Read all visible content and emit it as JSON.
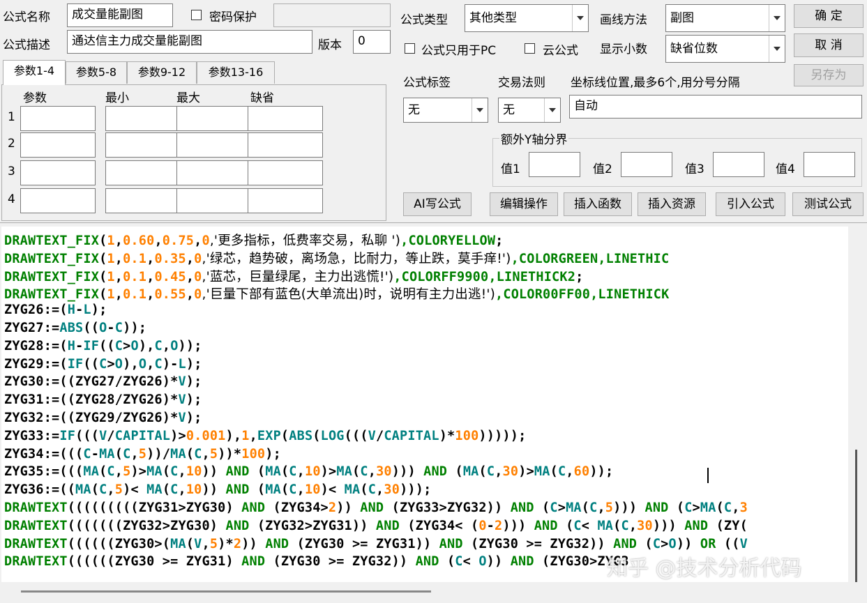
{
  "header": {
    "name_label": "公式名称",
    "name_value": "成交量能副图",
    "password_label": "密码保护",
    "desc_label": "公式描述",
    "desc_value": "通达信主力成交量能副图",
    "version_label": "版本",
    "version_value": "0"
  },
  "right_panel": {
    "type_label": "公式类型",
    "type_value": "其他类型",
    "draw_label": "画线方法",
    "draw_value": "副图",
    "pc_only_label": "公式只用于PC",
    "cloud_label": "云公式",
    "decimals_label": "显示小数",
    "decimals_value": "缺省位数",
    "tag_label": "公式标签",
    "tag_value": "无",
    "rule_label": "交易法则",
    "rule_value": "无",
    "axis_label": "坐标线位置,最多6个,用分号分隔",
    "axis_value": "自动",
    "extra_y_label": "额外Y轴分界",
    "values": [
      "值1",
      "值2",
      "值3",
      "值4"
    ]
  },
  "buttons": {
    "ok": "确 定",
    "cancel": "取 消",
    "save_as": "另存为",
    "ai": "AI写公式",
    "edit_ops": "编辑操作",
    "insert_func": "插入函数",
    "insert_res": "插入资源",
    "import": "引入公式",
    "test": "测试公式"
  },
  "tabs": [
    "参数1-4",
    "参数5-8",
    "参数9-12",
    "参数13-16"
  ],
  "params": {
    "headers": [
      "参数",
      "最小",
      "最大",
      "缺省"
    ],
    "rows": [
      "1",
      "2",
      "3",
      "4"
    ]
  },
  "colors": {
    "keyword": "#008000",
    "number": "#ff8000",
    "function": "#008080",
    "plain": "#000000",
    "string": "#000000"
  },
  "code_lines": [
    [
      [
        "DRAWTEXT_FIX",
        "k"
      ],
      [
        "(",
        "p"
      ],
      [
        "1",
        "n"
      ],
      [
        ",",
        "p"
      ],
      [
        "0.60",
        "n"
      ],
      [
        ",",
        "p"
      ],
      [
        "0.75",
        "n"
      ],
      [
        ",",
        "p"
      ],
      [
        "0",
        "n"
      ],
      [
        ",'更多指标，低费率交易，私聊 ')",
        "s"
      ],
      [
        ",COLORYELLOW",
        "k"
      ],
      [
        ";",
        "p"
      ]
    ],
    [
      [
        "DRAWTEXT_FIX",
        "k"
      ],
      [
        "(",
        "p"
      ],
      [
        "1",
        "n"
      ],
      [
        ",",
        "p"
      ],
      [
        "0.1",
        "n"
      ],
      [
        ",",
        "p"
      ],
      [
        "0.35",
        "n"
      ],
      [
        ",",
        "p"
      ],
      [
        "0",
        "n"
      ],
      [
        ",'绿芯，趋势破，离场急，比耐力，等止跌，莫手痒!')",
        "s"
      ],
      [
        ",COLORGREEN,LINETHIC",
        "k"
      ]
    ],
    [
      [
        "DRAWTEXT_FIX",
        "k"
      ],
      [
        "(",
        "p"
      ],
      [
        "1",
        "n"
      ],
      [
        ",",
        "p"
      ],
      [
        "0.1",
        "n"
      ],
      [
        ",",
        "p"
      ],
      [
        "0.45",
        "n"
      ],
      [
        ",",
        "p"
      ],
      [
        "0",
        "n"
      ],
      [
        ",'蓝芯，巨量绿尾，主力出逃慌!')",
        "s"
      ],
      [
        ",COLORFF9900,LINETHICK2",
        "k"
      ],
      [
        ";",
        "p"
      ]
    ],
    [
      [
        "DRAWTEXT_FIX",
        "k"
      ],
      [
        "(",
        "p"
      ],
      [
        "1",
        "n"
      ],
      [
        ",",
        "p"
      ],
      [
        "0.1",
        "n"
      ],
      [
        ",",
        "p"
      ],
      [
        "0.55",
        "n"
      ],
      [
        ",",
        "p"
      ],
      [
        "0",
        "n"
      ],
      [
        ",'巨量下部有蓝色(大单流出)时，说明有主力出逃!')",
        "s"
      ],
      [
        ",COLOR00FF00,LINETHICK",
        "k"
      ]
    ],
    [
      [
        "ZYG26:=(",
        "p"
      ],
      [
        "H",
        "f"
      ],
      [
        "-",
        "p"
      ],
      [
        "L",
        "f"
      ],
      [
        ");",
        "p"
      ]
    ],
    [
      [
        "ZYG27:=",
        "p"
      ],
      [
        "ABS",
        "f"
      ],
      [
        "((",
        "p"
      ],
      [
        "O",
        "f"
      ],
      [
        "-",
        "p"
      ],
      [
        "C",
        "f"
      ],
      [
        "));",
        "p"
      ]
    ],
    [
      [
        "ZYG28:=(",
        "p"
      ],
      [
        "H",
        "f"
      ],
      [
        "-",
        "p"
      ],
      [
        "IF",
        "f"
      ],
      [
        "((",
        "p"
      ],
      [
        "C",
        "f"
      ],
      [
        ">",
        "p"
      ],
      [
        "O",
        "f"
      ],
      [
        "),",
        "p"
      ],
      [
        "C",
        "f"
      ],
      [
        ",",
        "p"
      ],
      [
        "O",
        "f"
      ],
      [
        "));",
        "p"
      ]
    ],
    [
      [
        "ZYG29:=(",
        "p"
      ],
      [
        "IF",
        "f"
      ],
      [
        "((",
        "p"
      ],
      [
        "C",
        "f"
      ],
      [
        ">",
        "p"
      ],
      [
        "O",
        "f"
      ],
      [
        "),",
        "p"
      ],
      [
        "O",
        "f"
      ],
      [
        ",",
        "p"
      ],
      [
        "C",
        "f"
      ],
      [
        ")-",
        "p"
      ],
      [
        "L",
        "f"
      ],
      [
        ");",
        "p"
      ]
    ],
    [
      [
        "ZYG30:=((ZYG27/ZYG26)*",
        "p"
      ],
      [
        "V",
        "f"
      ],
      [
        ");",
        "p"
      ]
    ],
    [
      [
        "ZYG31:=((ZYG28/ZYG26)*",
        "p"
      ],
      [
        "V",
        "f"
      ],
      [
        ");",
        "p"
      ]
    ],
    [
      [
        "ZYG32:=((ZYG29/ZYG26)*",
        "p"
      ],
      [
        "V",
        "f"
      ],
      [
        ");",
        "p"
      ]
    ],
    [
      [
        "ZYG33:=",
        "p"
      ],
      [
        "IF",
        "f"
      ],
      [
        "(((",
        "p"
      ],
      [
        "V",
        "f"
      ],
      [
        "/",
        "p"
      ],
      [
        "CAPITAL",
        "f"
      ],
      [
        ")>",
        "p"
      ],
      [
        "0.001",
        "n"
      ],
      [
        "),",
        "p"
      ],
      [
        "1",
        "n"
      ],
      [
        ",",
        "p"
      ],
      [
        "EXP",
        "f"
      ],
      [
        "(",
        "p"
      ],
      [
        "ABS",
        "f"
      ],
      [
        "(",
        "p"
      ],
      [
        "LOG",
        "f"
      ],
      [
        "(((",
        "p"
      ],
      [
        "V",
        "f"
      ],
      [
        "/",
        "p"
      ],
      [
        "CAPITAL",
        "f"
      ],
      [
        ")*",
        "p"
      ],
      [
        "100",
        "n"
      ],
      [
        ")))));",
        "p"
      ]
    ],
    [
      [
        "ZYG34:=(((",
        "p"
      ],
      [
        "C",
        "f"
      ],
      [
        "-",
        "p"
      ],
      [
        "MA",
        "f"
      ],
      [
        "(",
        "p"
      ],
      [
        "C",
        "f"
      ],
      [
        ",",
        "p"
      ],
      [
        "5",
        "n"
      ],
      [
        "))/",
        "p"
      ],
      [
        "MA",
        "f"
      ],
      [
        "(",
        "p"
      ],
      [
        "C",
        "f"
      ],
      [
        ",",
        "p"
      ],
      [
        "5",
        "n"
      ],
      [
        "))*",
        "p"
      ],
      [
        "100",
        "n"
      ],
      [
        ");",
        "p"
      ]
    ],
    [
      [
        "ZYG35:=(((",
        "p"
      ],
      [
        "MA",
        "f"
      ],
      [
        "(",
        "p"
      ],
      [
        "C",
        "f"
      ],
      [
        ",",
        "p"
      ],
      [
        "5",
        "n"
      ],
      [
        ")>",
        "p"
      ],
      [
        "MA",
        "f"
      ],
      [
        "(",
        "p"
      ],
      [
        "C",
        "f"
      ],
      [
        ",",
        "p"
      ],
      [
        "10",
        "n"
      ],
      [
        ")) ",
        "p"
      ],
      [
        "AND",
        "k"
      ],
      [
        " (",
        "p"
      ],
      [
        "MA",
        "f"
      ],
      [
        "(",
        "p"
      ],
      [
        "C",
        "f"
      ],
      [
        ",",
        "p"
      ],
      [
        "10",
        "n"
      ],
      [
        ")>",
        "p"
      ],
      [
        "MA",
        "f"
      ],
      [
        "(",
        "p"
      ],
      [
        "C",
        "f"
      ],
      [
        ",",
        "p"
      ],
      [
        "30",
        "n"
      ],
      [
        "))) ",
        "p"
      ],
      [
        "AND",
        "k"
      ],
      [
        " (",
        "p"
      ],
      [
        "MA",
        "f"
      ],
      [
        "(",
        "p"
      ],
      [
        "C",
        "f"
      ],
      [
        ",",
        "p"
      ],
      [
        "30",
        "n"
      ],
      [
        ")>",
        "p"
      ],
      [
        "MA",
        "f"
      ],
      [
        "(",
        "p"
      ],
      [
        "C",
        "f"
      ],
      [
        ",",
        "p"
      ],
      [
        "60",
        "n"
      ],
      [
        "));",
        "p"
      ]
    ],
    [
      [
        "ZYG36:=((",
        "p"
      ],
      [
        "MA",
        "f"
      ],
      [
        "(",
        "p"
      ],
      [
        "C",
        "f"
      ],
      [
        ",",
        "p"
      ],
      [
        "5",
        "n"
      ],
      [
        ")< ",
        "p"
      ],
      [
        "MA",
        "f"
      ],
      [
        "(",
        "p"
      ],
      [
        "C",
        "f"
      ],
      [
        ",",
        "p"
      ],
      [
        "10",
        "n"
      ],
      [
        ")) ",
        "p"
      ],
      [
        "AND",
        "k"
      ],
      [
        " (",
        "p"
      ],
      [
        "MA",
        "f"
      ],
      [
        "(",
        "p"
      ],
      [
        "C",
        "f"
      ],
      [
        ",",
        "p"
      ],
      [
        "10",
        "n"
      ],
      [
        ")< ",
        "p"
      ],
      [
        "MA",
        "f"
      ],
      [
        "(",
        "p"
      ],
      [
        "C",
        "f"
      ],
      [
        ",",
        "p"
      ],
      [
        "30",
        "n"
      ],
      [
        ")));",
        "p"
      ]
    ],
    [
      [
        "DRAWTEXT",
        "k"
      ],
      [
        "(((((((((ZYG31>ZYG30) ",
        "p"
      ],
      [
        "AND",
        "k"
      ],
      [
        " (ZYG34>",
        "p"
      ],
      [
        "2",
        "n"
      ],
      [
        ")) ",
        "p"
      ],
      [
        "AND",
        "k"
      ],
      [
        " (ZYG33>ZYG32)) ",
        "p"
      ],
      [
        "AND",
        "k"
      ],
      [
        " (",
        "p"
      ],
      [
        "C",
        "f"
      ],
      [
        ">",
        "p"
      ],
      [
        "MA",
        "f"
      ],
      [
        "(",
        "p"
      ],
      [
        "C",
        "f"
      ],
      [
        ",",
        "p"
      ],
      [
        "5",
        "n"
      ],
      [
        "))) ",
        "p"
      ],
      [
        "AND",
        "k"
      ],
      [
        " (",
        "p"
      ],
      [
        "C",
        "f"
      ],
      [
        ">",
        "p"
      ],
      [
        "MA",
        "f"
      ],
      [
        "(",
        "p"
      ],
      [
        "C",
        "f"
      ],
      [
        ",",
        "p"
      ],
      [
        "3",
        "n"
      ]
    ],
    [
      [
        "DRAWTEXT",
        "k"
      ],
      [
        "(((((((ZYG32>ZYG30) ",
        "p"
      ],
      [
        "AND",
        "k"
      ],
      [
        " (ZYG32>ZYG31)) ",
        "p"
      ],
      [
        "AND",
        "k"
      ],
      [
        " (ZYG34< (",
        "p"
      ],
      [
        "0",
        "n"
      ],
      [
        "-",
        "p"
      ],
      [
        "2",
        "n"
      ],
      [
        "))) ",
        "p"
      ],
      [
        "AND",
        "k"
      ],
      [
        " (",
        "p"
      ],
      [
        "C",
        "f"
      ],
      [
        "< ",
        "p"
      ],
      [
        "MA",
        "f"
      ],
      [
        "(",
        "p"
      ],
      [
        "C",
        "f"
      ],
      [
        ",",
        "p"
      ],
      [
        "30",
        "n"
      ],
      [
        "))) ",
        "p"
      ],
      [
        "AND",
        "k"
      ],
      [
        " (ZY(",
        "p"
      ]
    ],
    [
      [
        "DRAWTEXT",
        "k"
      ],
      [
        "((((((ZYG30>(",
        "p"
      ],
      [
        "MA",
        "f"
      ],
      [
        "(",
        "p"
      ],
      [
        "V",
        "f"
      ],
      [
        ",",
        "p"
      ],
      [
        "5",
        "n"
      ],
      [
        ")*",
        "p"
      ],
      [
        "2",
        "n"
      ],
      [
        ")) ",
        "p"
      ],
      [
        "AND",
        "k"
      ],
      [
        " (ZYG30 >= ZYG31)) ",
        "p"
      ],
      [
        "AND",
        "k"
      ],
      [
        " (ZYG30 >= ZYG32)) ",
        "p"
      ],
      [
        "AND",
        "k"
      ],
      [
        " (",
        "p"
      ],
      [
        "C",
        "f"
      ],
      [
        ">",
        "p"
      ],
      [
        "O",
        "f"
      ],
      [
        ")) ",
        "p"
      ],
      [
        "OR",
        "k"
      ],
      [
        " ((",
        "p"
      ],
      [
        "V",
        "f"
      ]
    ],
    [
      [
        "DRAWTEXT",
        "k"
      ],
      [
        "((((((ZYG30 >= ZYG31) ",
        "p"
      ],
      [
        "AND",
        "k"
      ],
      [
        " (ZYG30 >= ZYG32)) ",
        "p"
      ],
      [
        "AND",
        "k"
      ],
      [
        " (",
        "p"
      ],
      [
        "C",
        "f"
      ],
      [
        "< ",
        "p"
      ],
      [
        "O",
        "f"
      ],
      [
        ")) ",
        "p"
      ],
      [
        "AND",
        "k"
      ],
      [
        " (ZYG30>ZYG3",
        "p"
      ]
    ]
  ],
  "watermark": "知乎 @技术分析代码"
}
